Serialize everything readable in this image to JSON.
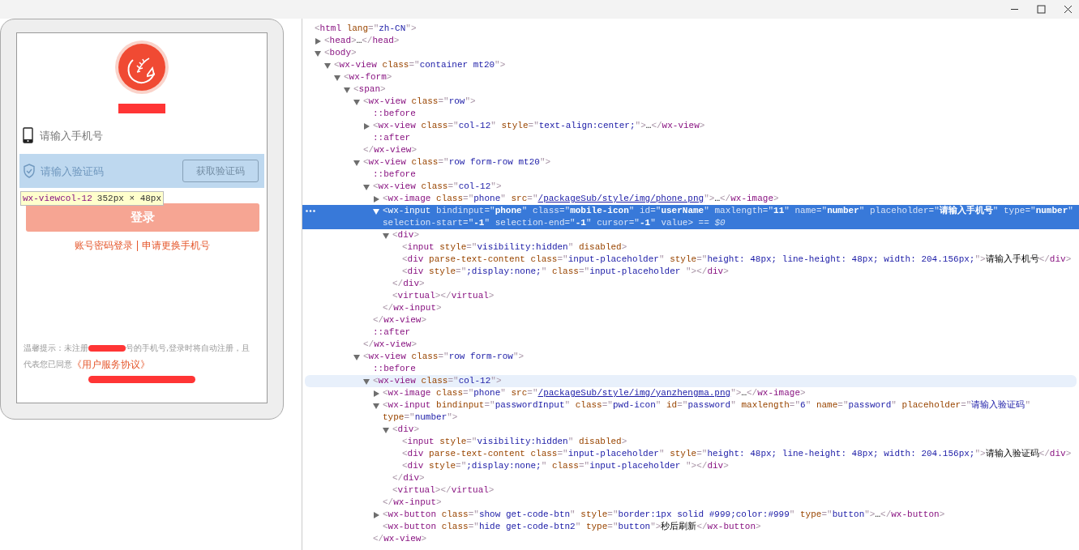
{
  "preview": {
    "phone_placeholder": "请输入手机号",
    "code_row": {
      "highlighted": true,
      "placeholder": "请输入验证码",
      "button": "获取验证码"
    },
    "inspect_tooltip": {
      "tag": "wx-view",
      "class": "col-12",
      "size": "352px × 48px"
    },
    "login_button": {
      "label": "登录",
      "disabled": true
    },
    "links": [
      "账号密码登录",
      "申请更换手机号"
    ],
    "notice_before": "温馨提示：未注册",
    "notice_after": "号的手机号,登录时将自动注册，且",
    "notice_line2": "代表您已同意",
    "agreement_link": "《用户服务协议》"
  },
  "elements": {
    "nodes": [
      {
        "open": "<html lang=\"zh-CN\">",
        "selected": false,
        "hovered": false,
        "children": [
          {
            "open": "<head>…</head>",
            "expanded": false,
            "selected": false,
            "hovered": false
          },
          {
            "open": "<body>",
            "expanded": true,
            "selected": false,
            "hovered": false,
            "children": [
              {
                "open": "<wx-view class=\"container mt20\">",
                "expanded": true,
                "selected": false,
                "hovered": false,
                "children": [
                  {
                    "open": "<wx-form>",
                    "expanded": true,
                    "selected": false,
                    "hovered": false,
                    "children": [
                      {
                        "open": "<span>",
                        "expanded": true,
                        "selected": false,
                        "hovered": false,
                        "children": [
                          {
                            "open": "<wx-view class=\"row\">",
                            "expanded": true,
                            "selected": false,
                            "hovered": false,
                            "close": "</wx-view>",
                            "children": [
                              {
                                "open": "::before",
                                "selected": false,
                                "hovered": false
                              },
                              {
                                "open": "<wx-view class=\"col-12\" style=\"text-align:center;\">…</wx-view>",
                                "expanded": false,
                                "selected": false,
                                "hovered": false
                              },
                              {
                                "open": "::after",
                                "selected": false,
                                "hovered": false
                              }
                            ]
                          },
                          {
                            "open": "<wx-view class=\"row form-row mt20\">",
                            "expanded": true,
                            "selected": false,
                            "hovered": false,
                            "close": "</wx-view>",
                            "children": [
                              {
                                "open": "::before",
                                "selected": false,
                                "hovered": false
                              },
                              {
                                "open": "<wx-view class=\"col-12\">",
                                "expanded": true,
                                "selected": false,
                                "hovered": false,
                                "close": "</wx-view>",
                                "children": [
                                  {
                                    "open": "<wx-image class=\"phone\" src=\"/packageSub/style/img/phone.png\">…</wx-image>",
                                    "expanded": false,
                                    "selected": false,
                                    "hovered": false
                                  },
                                  {
                                    "open": "<wx-input bindinput=\"phone\" class=\"mobile-icon\" id=\"userName\" maxlength=\"11\" name=\"number\" placeholder=\"请输入手机号\" type=\"number\" selection-start=\"-1\" selection-end=\"-1\" cursor=\"-1\" value>",
                                    "console_ref": "== $0",
                                    "expanded": true,
                                    "selected": true,
                                    "hovered": false,
                                    "close": "</wx-input>",
                                    "children": [
                                      {
                                        "open": "<div>",
                                        "expanded": true,
                                        "selected": false,
                                        "hovered": false,
                                        "close": "</div>",
                                        "children": [
                                          {
                                            "open": "<input style=\"visibility:hidden\" disabled>",
                                            "selected": false,
                                            "hovered": false
                                          },
                                          {
                                            "open": "<div parse-text-content class=\"input-placeholder\" style=\"height: 48px; line-height: 48px; width: 204.156px;\">请输入手机号</div>",
                                            "selected": false,
                                            "hovered": false
                                          },
                                          {
                                            "open": "<div style=\";display:none;\" class=\"input-placeholder \"></div>",
                                            "selected": false,
                                            "hovered": false
                                          }
                                        ]
                                      },
                                      {
                                        "open": "<virtual></virtual>",
                                        "selected": false,
                                        "hovered": false
                                      }
                                    ]
                                  }
                                ]
                              },
                              {
                                "open": "::after",
                                "selected": false,
                                "hovered": false
                              }
                            ]
                          },
                          {
                            "open": "<wx-view class=\"row form-row\">",
                            "expanded": true,
                            "selected": false,
                            "hovered": false,
                            "children": [
                              {
                                "open": "::before",
                                "selected": false,
                                "hovered": false
                              },
                              {
                                "open": "<wx-view class=\"col-12\">",
                                "expanded": true,
                                "selected": false,
                                "hovered": true,
                                "close": "</wx-view>",
                                "children": [
                                  {
                                    "open": "<wx-image class=\"phone\" src=\"/packageSub/style/img/yanzhengma.png\">…</wx-image>",
                                    "expanded": false,
                                    "selected": false,
                                    "hovered": false
                                  },
                                  {
                                    "open": "<wx-input bindinput=\"passwordInput\" class=\"pwd-icon\" id=\"password\" maxlength=\"6\" name=\"password\" placeholder=\"请输入验证码\" type=\"number\">",
                                    "expanded": true,
                                    "selected": false,
                                    "hovered": false,
                                    "close": "</wx-input>",
                                    "children": [
                                      {
                                        "open": "<div>",
                                        "expanded": true,
                                        "selected": false,
                                        "hovered": false,
                                        "close": "</div>",
                                        "children": [
                                          {
                                            "open": "<input style=\"visibility:hidden\" disabled>",
                                            "selected": false,
                                            "hovered": false
                                          },
                                          {
                                            "open": "<div parse-text-content class=\"input-placeholder\" style=\"height: 48px; line-height: 48px; width: 204.156px;\">请输入验证码</div>",
                                            "selected": false,
                                            "hovered": false
                                          },
                                          {
                                            "open": "<div style=\";display:none;\" class=\"input-placeholder \"></div>",
                                            "selected": false,
                                            "hovered": false
                                          }
                                        ]
                                      },
                                      {
                                        "open": "<virtual></virtual>",
                                        "selected": false,
                                        "hovered": false
                                      }
                                    ]
                                  },
                                  {
                                    "open": "<wx-button class=\"show get-code-btn\" style=\"border:1px solid #999;color:#999\" type=\"button\">…</wx-button>",
                                    "expanded": false,
                                    "selected": false,
                                    "hovered": false
                                  },
                                  {
                                    "open": "<wx-button class=\"hide get-code-btn2\" type=\"button\">秒后刷新</wx-button>",
                                    "selected": false,
                                    "hovered": false
                                  }
                                ]
                              }
                            ]
                          }
                        ]
                      }
                    ]
                  }
                ]
              }
            ]
          }
        ]
      }
    ]
  }
}
